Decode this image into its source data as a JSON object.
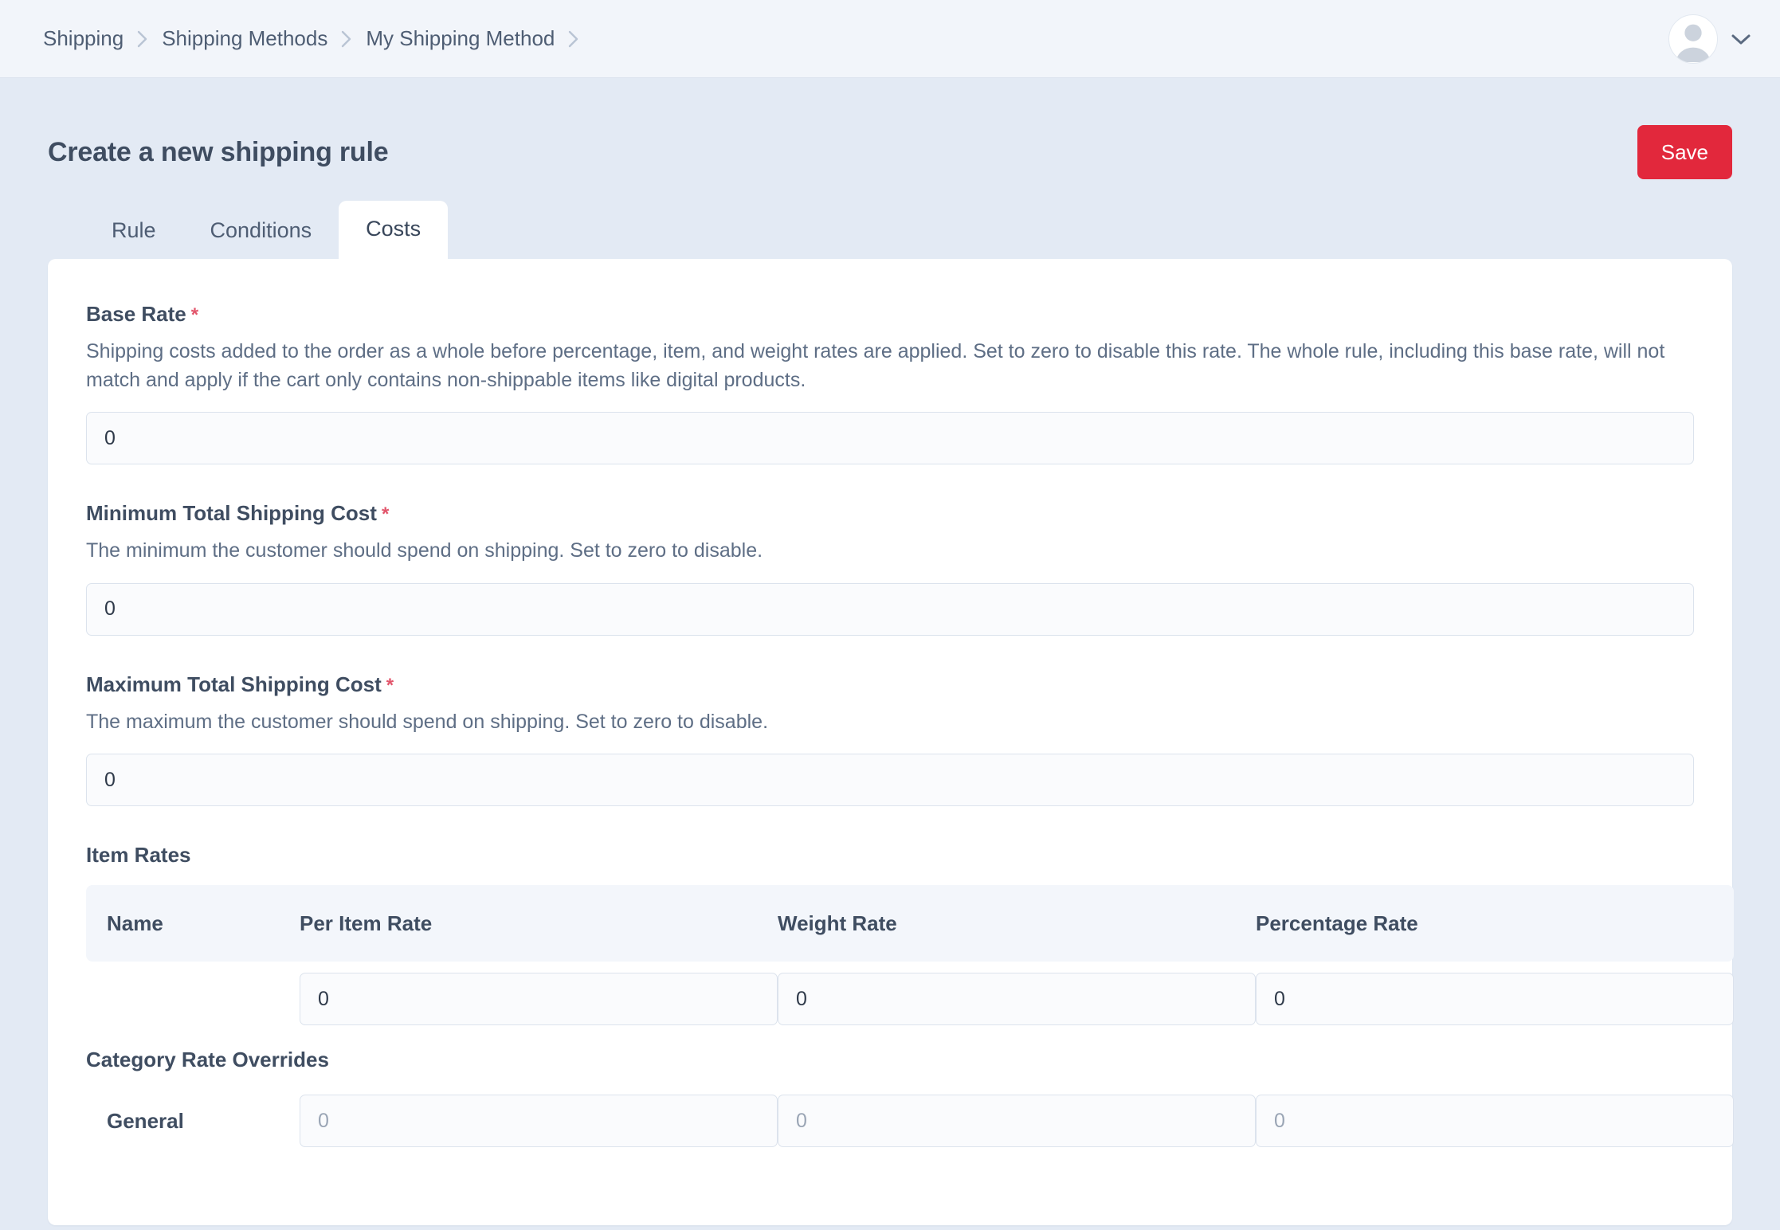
{
  "breadcrumb": {
    "items": [
      {
        "label": "Shipping"
      },
      {
        "label": "Shipping Methods"
      },
      {
        "label": "My Shipping Method"
      }
    ]
  },
  "user_menu": {
    "avatar_icon": "user-avatar-icon",
    "caret_icon": "chevron-down-icon"
  },
  "header": {
    "title": "Create a new shipping rule",
    "save_label": "Save"
  },
  "tabs": [
    {
      "label": "Rule",
      "active": false
    },
    {
      "label": "Conditions",
      "active": false
    },
    {
      "label": "Costs",
      "active": true
    }
  ],
  "fields": {
    "base_rate": {
      "label": "Base Rate",
      "required_marker": "*",
      "description": "Shipping costs added to the order as a whole before percentage, item, and weight rates are applied. Set to zero to disable this rate. The whole rule, including this base rate, will not match and apply if the cart only contains non-shippable items like digital products.",
      "value": "0"
    },
    "minimum_total": {
      "label": "Minimum Total Shipping Cost",
      "required_marker": "*",
      "description": "The minimum the customer should spend on shipping. Set to zero to disable.",
      "value": "0"
    },
    "maximum_total": {
      "label": "Maximum Total Shipping Cost",
      "required_marker": "*",
      "description": "The maximum the customer should spend on shipping. Set to zero to disable.",
      "value": "0"
    }
  },
  "item_rates": {
    "title": "Item Rates",
    "columns": {
      "name": "Name",
      "per_item_rate": "Per Item Rate",
      "weight_rate": "Weight Rate",
      "percentage_rate": "Percentage Rate"
    },
    "default_row": {
      "name": "",
      "per_item_rate": "0",
      "weight_rate": "0",
      "percentage_rate": "0"
    },
    "overrides_title": "Category Rate Overrides",
    "overrides": [
      {
        "name": "General",
        "per_item_rate_placeholder": "0",
        "weight_rate_placeholder": "0",
        "percentage_rate_placeholder": "0",
        "per_item_rate": "",
        "weight_rate": "",
        "percentage_rate": ""
      }
    ]
  },
  "colors": {
    "accent_save": "#e2283c",
    "required": "#e2556b",
    "page_background": "#e3eaf4",
    "topbar_background": "#f2f5fa",
    "card_background": "#ffffff",
    "table_header_background": "#f3f6fb"
  }
}
